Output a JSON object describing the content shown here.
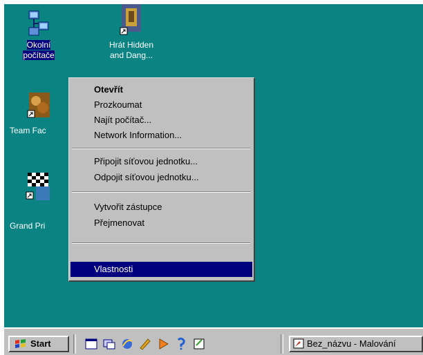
{
  "desktop": {
    "icons": [
      {
        "label_1": "Okolní",
        "label_2": "počítače",
        "icon": "network-neighborhood-icon"
      },
      {
        "label_1": "Hrát Hidden",
        "label_2": "and Dang...",
        "icon": "game-shortcut-icon"
      },
      {
        "label": "Team Fac",
        "icon": "team-factory-icon"
      },
      {
        "label": "Grand Pri",
        "icon": "grand-prix-icon"
      }
    ]
  },
  "context_menu": {
    "items": [
      {
        "label": "Otevřít",
        "bold": true
      },
      {
        "label": "Prozkoumat"
      },
      {
        "label": "Najít počítač..."
      },
      {
        "label": "Network Information..."
      },
      {
        "label": "Připojit síťovou jednotku..."
      },
      {
        "label": "Odpojit síťovou jednotku..."
      },
      {
        "label": "Vytvořit zástupce"
      },
      {
        "label": "Přejmenovat"
      },
      {
        "label": "Vlastnosti",
        "highlighted": true
      }
    ]
  },
  "taskbar": {
    "start_label": "Start",
    "quick_launch": [
      "show-desktop-icon",
      "channels-icon",
      "ie-icon",
      "outlook-icon",
      "media-icon",
      "help-icon",
      "notepad-icon"
    ],
    "task_label": "Bez_názvu - Malování"
  },
  "colors": {
    "desktop": "#0b8383",
    "menu": "#c0c0c0",
    "highlight": "#00007f"
  }
}
